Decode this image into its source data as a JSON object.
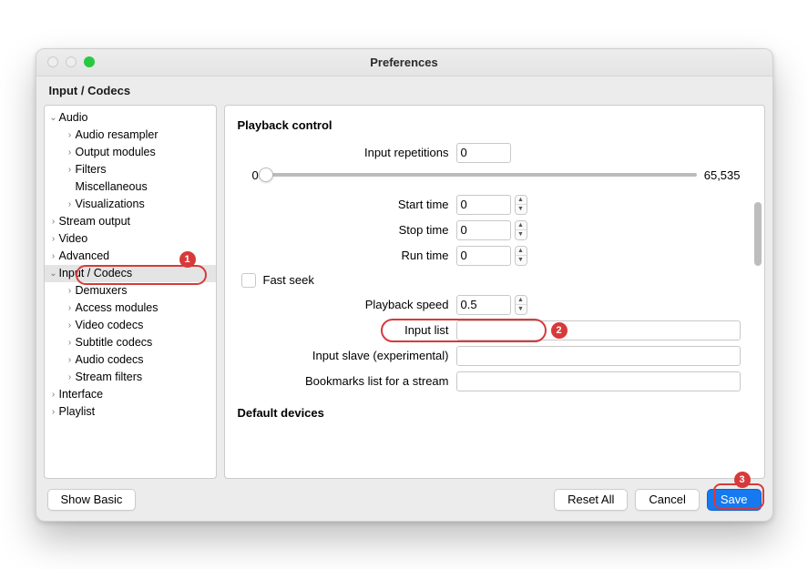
{
  "window": {
    "title": "Preferences"
  },
  "section_title": "Input / Codecs",
  "tree": {
    "items": [
      {
        "label": "Audio",
        "depth": 1,
        "chev": "v"
      },
      {
        "label": "Audio resampler",
        "depth": 2,
        "chev": ">"
      },
      {
        "label": "Output modules",
        "depth": 2,
        "chev": ">"
      },
      {
        "label": "Filters",
        "depth": 2,
        "chev": ">"
      },
      {
        "label": "Miscellaneous",
        "depth": 2,
        "chev": ""
      },
      {
        "label": "Visualizations",
        "depth": 2,
        "chev": ">"
      },
      {
        "label": "Stream output",
        "depth": 1,
        "chev": ">"
      },
      {
        "label": "Video",
        "depth": 1,
        "chev": ">"
      },
      {
        "label": "Advanced",
        "depth": 1,
        "chev": ">"
      },
      {
        "label": "Input / Codecs",
        "depth": 1,
        "chev": "v",
        "selected": true
      },
      {
        "label": "Demuxers",
        "depth": 2,
        "chev": ">"
      },
      {
        "label": "Access modules",
        "depth": 2,
        "chev": ">"
      },
      {
        "label": "Video codecs",
        "depth": 2,
        "chev": ">"
      },
      {
        "label": "Subtitle codecs",
        "depth": 2,
        "chev": ">"
      },
      {
        "label": "Audio codecs",
        "depth": 2,
        "chev": ">"
      },
      {
        "label": "Stream filters",
        "depth": 2,
        "chev": ">"
      },
      {
        "label": "Interface",
        "depth": 1,
        "chev": ">"
      },
      {
        "label": "Playlist",
        "depth": 1,
        "chev": ">"
      }
    ]
  },
  "playback": {
    "group_header": "Playback control",
    "input_repetitions_label": "Input repetitions",
    "input_repetitions_value": "0",
    "slider_min": "0",
    "slider_max": "65,535",
    "start_time_label": "Start time",
    "start_time_value": "0",
    "stop_time_label": "Stop time",
    "stop_time_value": "0",
    "run_time_label": "Run time",
    "run_time_value": "0",
    "fast_seek_label": "Fast seek",
    "playback_speed_label": "Playback speed",
    "playback_speed_value": "0.5",
    "input_list_label": "Input list",
    "input_list_value": "",
    "input_slave_label": "Input slave (experimental)",
    "input_slave_value": "",
    "bookmarks_label": "Bookmarks list for a stream",
    "bookmarks_value": ""
  },
  "default_devices_header": "Default devices",
  "footer": {
    "show_basic": "Show Basic",
    "reset_all": "Reset All",
    "cancel": "Cancel",
    "save": "Save"
  },
  "annotations": {
    "b1": "1",
    "b2": "2",
    "b3": "3"
  }
}
